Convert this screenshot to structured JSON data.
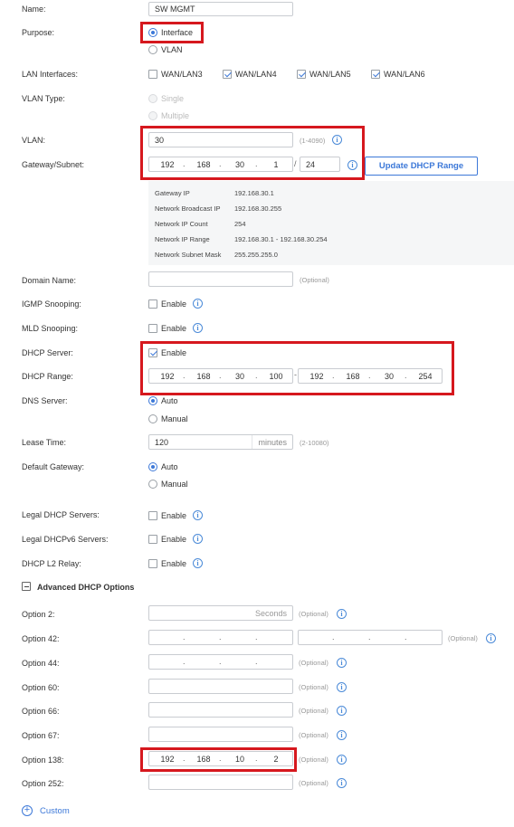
{
  "fields": {
    "name": {
      "label": "Name:",
      "value": "SW MGMT"
    },
    "purpose": {
      "label": "Purpose:",
      "options": [
        "Interface",
        "VLAN"
      ],
      "selected": "Interface"
    },
    "lan_interfaces": {
      "label": "LAN Interfaces:",
      "items": [
        {
          "label": "WAN/LAN3",
          "checked": false
        },
        {
          "label": "WAN/LAN4",
          "checked": true
        },
        {
          "label": "WAN/LAN5",
          "checked": true
        },
        {
          "label": "WAN/LAN6",
          "checked": true
        }
      ]
    },
    "vlan_type": {
      "label": "VLAN Type:",
      "options": [
        "Single",
        "Multiple"
      ]
    },
    "vlan": {
      "label": "VLAN:",
      "value": "30",
      "hint": "(1-4090)"
    },
    "gateway_subnet": {
      "label": "Gateway/Subnet:",
      "octets": [
        "192",
        "168",
        "30",
        "1"
      ],
      "mask": "24",
      "button": "Update DHCP Range"
    },
    "network_info": [
      {
        "key": "Gateway IP",
        "value": "192.168.30.1"
      },
      {
        "key": "Network Broadcast IP",
        "value": "192.168.30.255"
      },
      {
        "key": "Network IP Count",
        "value": "254"
      },
      {
        "key": "Network IP Range",
        "value": "192.168.30.1 - 192.168.30.254"
      },
      {
        "key": "Network Subnet Mask",
        "value": "255.255.255.0"
      }
    ],
    "domain_name": {
      "label": "Domain Name:",
      "hint": "(Optional)"
    },
    "igmp_snooping": {
      "label": "IGMP Snooping:",
      "text": "Enable"
    },
    "mld_snooping": {
      "label": "MLD Snooping:",
      "text": "Enable"
    },
    "dhcp_server": {
      "label": "DHCP Server:",
      "text": "Enable",
      "checked": true
    },
    "dhcp_range": {
      "label": "DHCP Range:",
      "start": [
        "192",
        "168",
        "30",
        "100"
      ],
      "end": [
        "192",
        "168",
        "30",
        "254"
      ]
    },
    "dns_server": {
      "label": "DNS Server:",
      "options": [
        "Auto",
        "Manual"
      ],
      "selected": "Auto"
    },
    "lease_time": {
      "label": "Lease Time:",
      "value": "120",
      "unit": "minutes",
      "hint": "(2-10080)"
    },
    "default_gateway": {
      "label": "Default Gateway:",
      "options": [
        "Auto",
        "Manual"
      ],
      "selected": "Auto"
    },
    "legal_dhcp_servers": {
      "label": "Legal DHCP Servers:",
      "text": "Enable"
    },
    "legal_dhcpv6_servers": {
      "label": "Legal DHCPv6 Servers:",
      "text": "Enable"
    },
    "dhcp_l2_relay": {
      "label": "DHCP L2 Relay:",
      "text": "Enable"
    }
  },
  "advanced": {
    "title": "Advanced DHCP Options",
    "option2": {
      "label": "Option 2:",
      "placeholder": "Seconds",
      "hint": "(Optional)"
    },
    "option42": {
      "label": "Option 42:",
      "hint": "(Optional)"
    },
    "option44": {
      "label": "Option 44:",
      "hint": "(Optional)"
    },
    "option60": {
      "label": "Option 60:",
      "hint": "(Optional)"
    },
    "option66": {
      "label": "Option 66:",
      "hint": "(Optional)"
    },
    "option67": {
      "label": "Option 67:",
      "hint": "(Optional)"
    },
    "option138": {
      "label": "Option 138:",
      "octets": [
        "192",
        "168",
        "10",
        "2"
      ],
      "hint": "(Optional)"
    },
    "option252": {
      "label": "Option 252:",
      "hint": "(Optional)"
    },
    "custom": "Custom"
  },
  "colors": {
    "accent": "#3c78d8",
    "highlight": "#d6181e"
  }
}
